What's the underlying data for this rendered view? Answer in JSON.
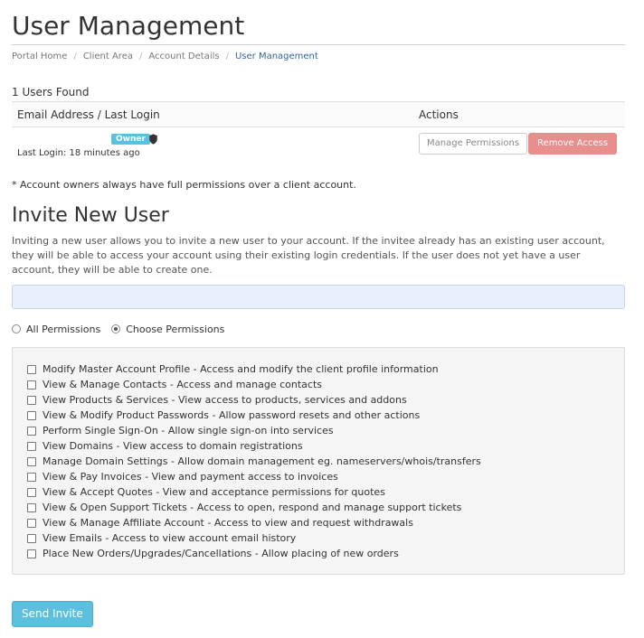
{
  "page": {
    "title": "User Management"
  },
  "breadcrumb": [
    {
      "label": "Portal Home"
    },
    {
      "label": "Client Area"
    },
    {
      "label": "Account Details"
    },
    {
      "label": "User Management"
    }
  ],
  "users": {
    "count_text": "1 Users Found",
    "columns": [
      "Email Address / Last Login",
      "Actions"
    ],
    "rows": [
      {
        "badge": "Owner",
        "last_login": "Last Login: 18 minutes ago",
        "manage_label": "Manage Permissions",
        "remove_label": "Remove Access"
      }
    ],
    "owner_note": "* Account owners always have full permissions over a client account."
  },
  "invite": {
    "title": "Invite New User",
    "description": "Inviting a new user allows you to invite a new user to your account. If the invitee already has an existing user account, they will be able to access your account using their existing login credentials. If the user does not yet have a user account, they will be able to create one.",
    "email_value": "",
    "email_placeholder": "",
    "options": {
      "all": "All Permissions",
      "choose": "Choose Permissions",
      "selected": "choose"
    },
    "permissions": [
      "Modify Master Account Profile - Access and modify the client profile information",
      "View & Manage Contacts - Access and manage contacts",
      "View Products & Services - View access to products, services and addons",
      "View & Modify Product Passwords - Allow password resets and other actions",
      "Perform Single Sign-On - Allow single sign-on into services",
      "View Domains - View access to domain registrations",
      "Manage Domain Settings - Allow domain management eg. nameservers/whois/transfers",
      "View & Pay Invoices - View and payment access to invoices",
      "View & Accept Quotes - View and acceptance permissions for quotes",
      "View & Open Support Tickets - Access to open, respond and manage support tickets",
      "View & Manage Affiliate Account - Access to view and request withdrawals",
      "View Emails - Access to view account email history",
      "Place New Orders/Upgrades/Cancellations - Allow placing of new orders"
    ],
    "send_label": "Send Invite"
  },
  "colors": {
    "accent": "#5bc0de",
    "danger": "#e88e8c",
    "breadcrumb_active": "#336699"
  },
  "icons": {
    "owner_shield": "shield-icon"
  }
}
